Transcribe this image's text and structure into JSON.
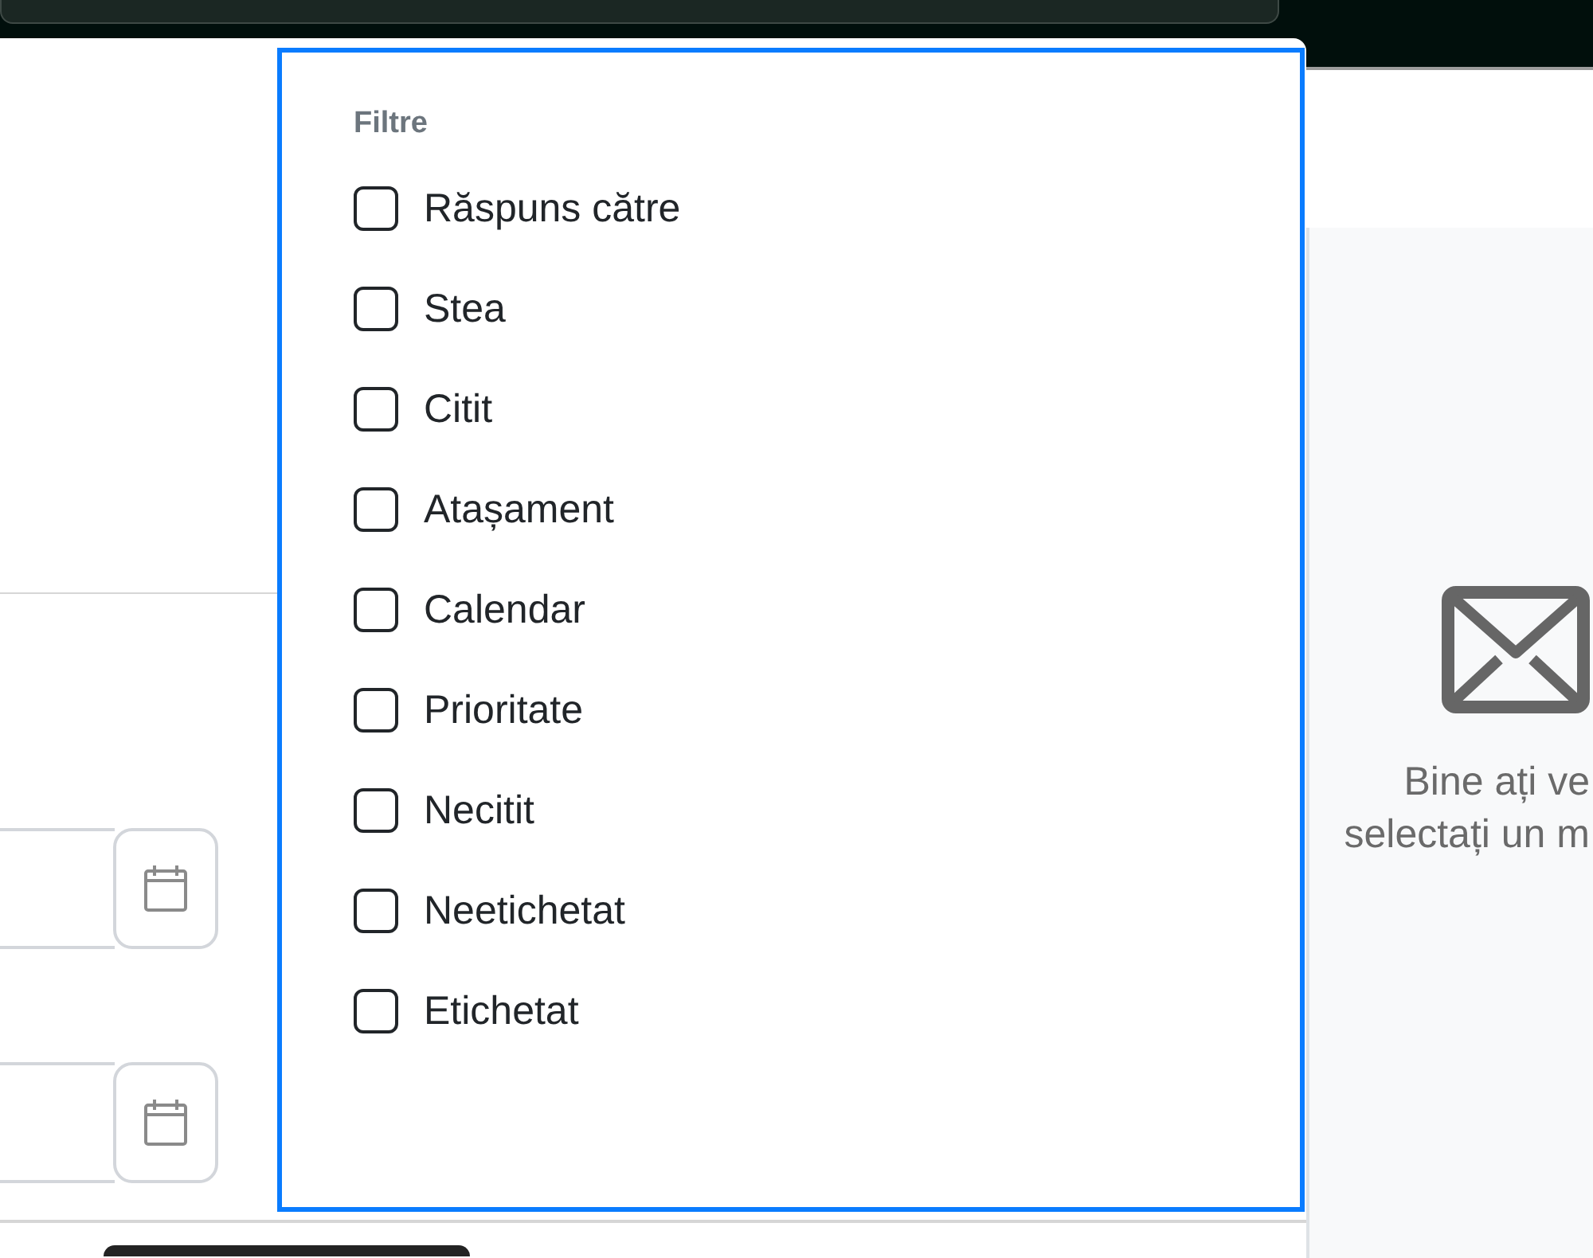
{
  "filter_menu": {
    "heading": "Filtre",
    "options": [
      {
        "label": "Răspuns către",
        "checked": false
      },
      {
        "label": "Stea",
        "checked": false
      },
      {
        "label": "Citit",
        "checked": false
      },
      {
        "label": "Atașament",
        "checked": false
      },
      {
        "label": "Calendar",
        "checked": false
      },
      {
        "label": "Prioritate",
        "checked": false
      },
      {
        "label": "Necitit",
        "checked": false
      },
      {
        "label": "Neetichetat",
        "checked": false
      },
      {
        "label": "Etichetat",
        "checked": false
      }
    ]
  },
  "preview": {
    "message_lines": [
      "Bine ați ve",
      "selectați un m"
    ]
  }
}
